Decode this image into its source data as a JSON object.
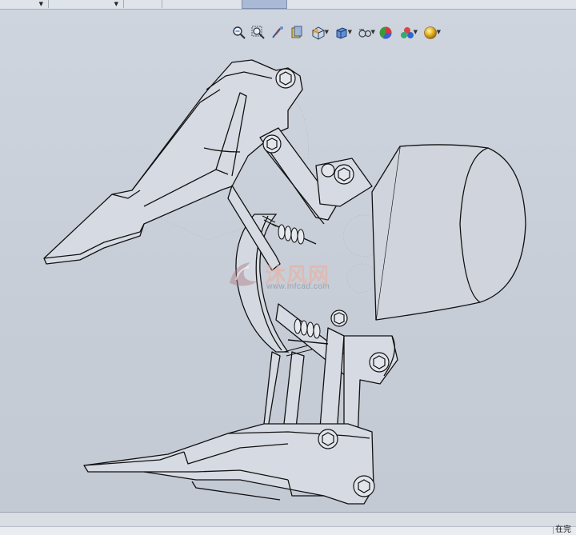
{
  "window": {
    "status_text": "在完"
  },
  "heads_up_toolbar": {
    "buttons": [
      {
        "icon": "zoom-to-fit-icon",
        "has_dropdown": false
      },
      {
        "icon": "zoom-to-area-icon",
        "has_dropdown": false
      },
      {
        "icon": "previous-view-icon",
        "has_dropdown": false
      },
      {
        "icon": "section-view-icon",
        "has_dropdown": false
      },
      {
        "icon": "view-orientation-icon",
        "has_dropdown": true
      },
      {
        "icon": "display-style-icon",
        "has_dropdown": true
      },
      {
        "icon": "hide-show-items-icon",
        "has_dropdown": true
      },
      {
        "icon": "edit-appearance-icon",
        "has_dropdown": false
      },
      {
        "icon": "apply-scene-icon",
        "has_dropdown": true
      },
      {
        "icon": "view-settings-icon",
        "has_dropdown": true
      }
    ]
  },
  "viewport": {
    "model": "mechanical gripper assembly (wireframe)",
    "background_color": "#cbd1da",
    "line_color": "#111111"
  },
  "watermark": {
    "text": "沐风网",
    "url": "www.mfcad.com"
  }
}
